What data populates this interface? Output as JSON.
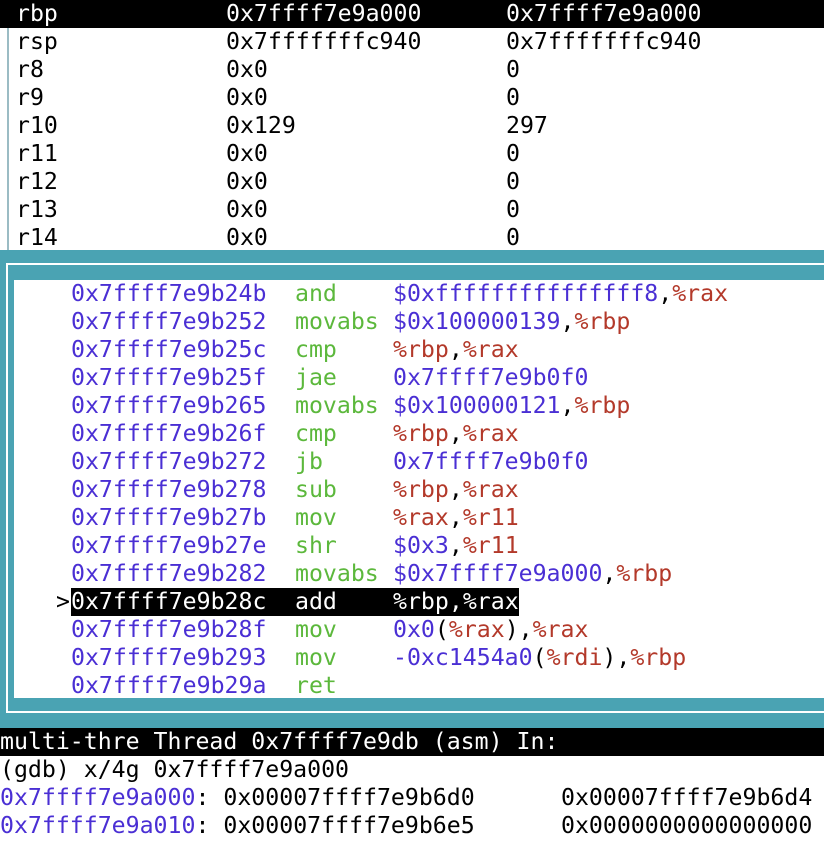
{
  "colors": {
    "teal": "#4aa3b3",
    "address": "#4a2fd4",
    "opcode": "#5cb83c",
    "register": "#b3392a"
  },
  "registers": [
    {
      "name": "rbp",
      "hex": "0x7ffff7e9a000",
      "value": "0x7ffff7e9a000",
      "selected": true
    },
    {
      "name": "rsp",
      "hex": "0x7fffffffc940",
      "value": "0x7fffffffc940"
    },
    {
      "name": "r8",
      "hex": "0x0",
      "value": "0"
    },
    {
      "name": "r9",
      "hex": "0x0",
      "value": "0"
    },
    {
      "name": "r10",
      "hex": "0x129",
      "value": "297"
    },
    {
      "name": "r11",
      "hex": "0x0",
      "value": "0"
    },
    {
      "name": "r12",
      "hex": "0x0",
      "value": "0"
    },
    {
      "name": "r13",
      "hex": "0x0",
      "value": "0"
    },
    {
      "name": "r14",
      "hex": "0x0",
      "value": "0"
    }
  ],
  "asm": [
    {
      "addr": "0x7ffff7e9b24b",
      "op": "and",
      "args": [
        [
          "$0xfffffffffffffff8",
          "imm"
        ],
        [
          ",",
          ""
        ],
        [
          "%rax",
          "regn"
        ]
      ]
    },
    {
      "addr": "0x7ffff7e9b252",
      "op": "movabs",
      "args": [
        [
          "$0x100000139",
          "imm"
        ],
        [
          ",",
          ""
        ],
        [
          "%rbp",
          "regn"
        ]
      ]
    },
    {
      "addr": "0x7ffff7e9b25c",
      "op": "cmp",
      "args": [
        [
          "%rbp",
          "regn"
        ],
        [
          ",",
          ""
        ],
        [
          "%rax",
          "regn"
        ]
      ]
    },
    {
      "addr": "0x7ffff7e9b25f",
      "op": "jae",
      "args": [
        [
          "0x7ffff7e9b0f0",
          "imm"
        ]
      ]
    },
    {
      "addr": "0x7ffff7e9b265",
      "op": "movabs",
      "args": [
        [
          "$0x100000121",
          "imm"
        ],
        [
          ",",
          ""
        ],
        [
          "%rbp",
          "regn"
        ]
      ]
    },
    {
      "addr": "0x7ffff7e9b26f",
      "op": "cmp",
      "args": [
        [
          "%rbp",
          "regn"
        ],
        [
          ",",
          ""
        ],
        [
          "%rax",
          "regn"
        ]
      ]
    },
    {
      "addr": "0x7ffff7e9b272",
      "op": "jb",
      "args": [
        [
          "0x7ffff7e9b0f0",
          "imm"
        ]
      ]
    },
    {
      "addr": "0x7ffff7e9b278",
      "op": "sub",
      "args": [
        [
          "%rbp",
          "regn"
        ],
        [
          ",",
          ""
        ],
        [
          "%rax",
          "regn"
        ]
      ]
    },
    {
      "addr": "0x7ffff7e9b27b",
      "op": "mov",
      "args": [
        [
          "%rax",
          "regn"
        ],
        [
          ",",
          ""
        ],
        [
          "%r11",
          "regn"
        ]
      ]
    },
    {
      "addr": "0x7ffff7e9b27e",
      "op": "shr",
      "args": [
        [
          "$0x3",
          "imm"
        ],
        [
          ",",
          ""
        ],
        [
          "%r11",
          "regn"
        ]
      ]
    },
    {
      "addr": "0x7ffff7e9b282",
      "op": "movabs",
      "args": [
        [
          "$0x7ffff7e9a000",
          "imm"
        ],
        [
          ",",
          ""
        ],
        [
          "%rbp",
          "regn"
        ]
      ]
    },
    {
      "addr": "0x7ffff7e9b28c",
      "op": "add",
      "args": [
        [
          "%rbp",
          "regn"
        ],
        [
          ",",
          ""
        ],
        [
          "%rax",
          "regn"
        ]
      ],
      "current": true,
      "marker": ">"
    },
    {
      "addr": "0x7ffff7e9b28f",
      "op": "mov",
      "args": [
        [
          "0x0",
          "imm"
        ],
        [
          "(",
          ""
        ],
        [
          "%rax",
          "regn"
        ],
        [
          "),",
          ""
        ],
        [
          "%rax",
          "regn"
        ]
      ]
    },
    {
      "addr": "0x7ffff7e9b293",
      "op": "mov",
      "args": [
        [
          "-0xc1454a0",
          "imm"
        ],
        [
          "(",
          ""
        ],
        [
          "%rdi",
          "regn"
        ],
        [
          "),",
          ""
        ],
        [
          "%rbp",
          "regn"
        ]
      ]
    },
    {
      "addr": "0x7ffff7e9b29a",
      "op": "ret",
      "args": []
    }
  ],
  "status": "multi-thre Thread 0x7ffff7e9db (asm) In:",
  "console": {
    "command": "(gdb) x/4g 0x7ffff7e9a000",
    "lines": [
      {
        "addr": "0x7ffff7e9a000",
        "v1": "0x00007ffff7e9b6d0",
        "v2": "0x00007ffff7e9b6d4"
      },
      {
        "addr": "0x7ffff7e9a010",
        "v1": "0x00007ffff7e9b6e5",
        "v2": "0x0000000000000000"
      }
    ]
  }
}
